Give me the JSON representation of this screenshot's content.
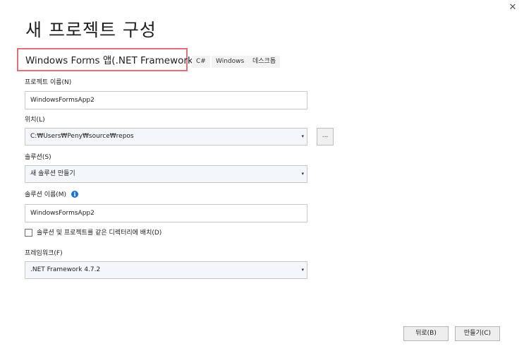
{
  "window": {
    "close_glyph": "✕",
    "close_icon": "close-icon"
  },
  "header": {
    "title": "새 프로젝트 구성"
  },
  "template": {
    "name": "Windows Forms 앱(.NET Framework)",
    "tags": [
      "C#",
      "Windows",
      "데스크톱"
    ],
    "highlight_color": "#e26f7a"
  },
  "form": {
    "project_name": {
      "label": "프로젝트 이름(N)",
      "value": "WindowsFormsApp2"
    },
    "location": {
      "label": "위치(L)",
      "value": "C:₩Users₩Peny₩source₩repos",
      "browse_label": "..."
    },
    "solution": {
      "label": "솔루션(S)",
      "value": "새 솔루션 만들기"
    },
    "solution_name": {
      "label": "솔루션 이름(M)",
      "value": "WindowsFormsApp2",
      "info_icon": "info-icon",
      "info_glyph": "i"
    },
    "same_dir": {
      "label": "솔루션 및 프로젝트를 같은 디렉터리에 배치(D)",
      "checked": false
    },
    "framework": {
      "label": "프레임워크(F)",
      "value": ".NET Framework 4.7.2"
    },
    "dropdown_glyph": "▾"
  },
  "footer": {
    "back_label": "뒤로(B)",
    "create_label": "만들기(C)"
  }
}
